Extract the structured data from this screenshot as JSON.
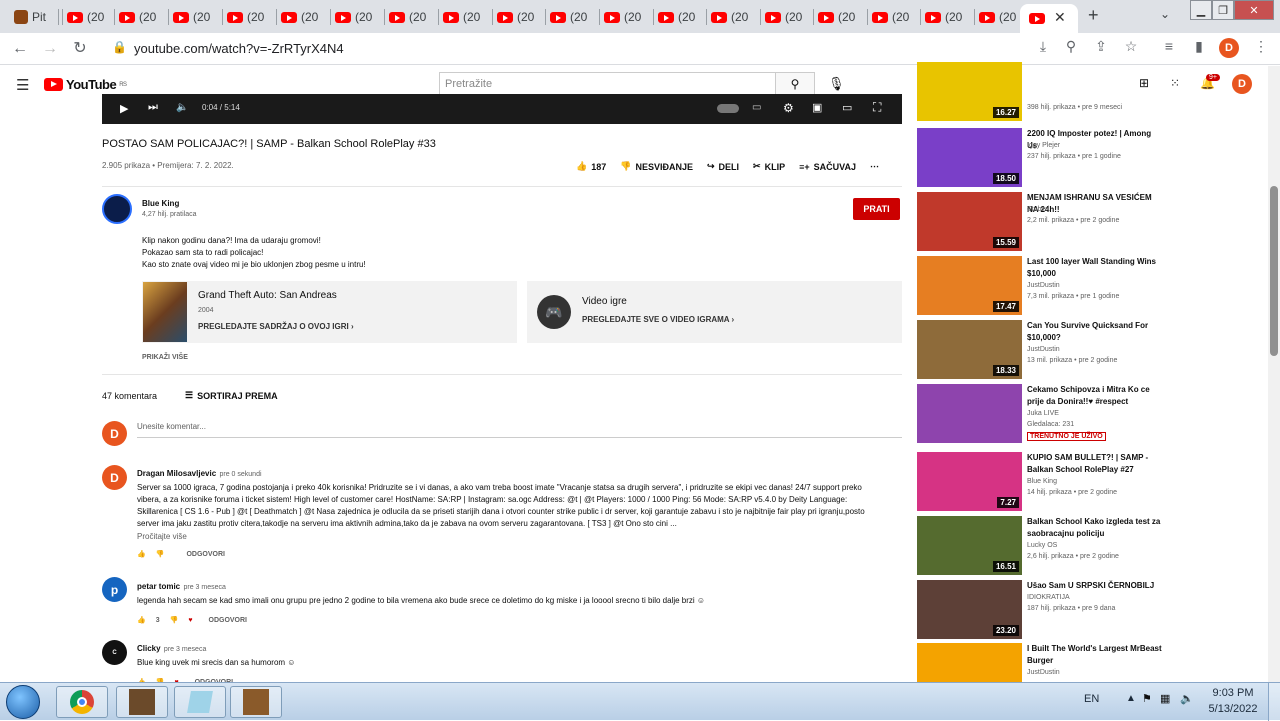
{
  "browser": {
    "first_tab_label": "Pit",
    "yt_tab_label": "(20",
    "url": "youtube.com/watch?v=-ZrRTyrX4N4",
    "profile_initial": "D"
  },
  "yt": {
    "search_placeholder": "Pretražite",
    "logo_text": "YouTube",
    "region": "RS",
    "notif_count": "9+",
    "avatar_initial": "D"
  },
  "player": {
    "time": "0:04 / 5:14"
  },
  "video": {
    "title": "POSTAO SAM POLICAJAC?! | SAMP - Balkan School RolePlay #33",
    "meta": "2.905 prikaza • Premijera: 7. 2. 2022.",
    "likes": "187",
    "dislike": "NESVIĐANJE",
    "share": "DELI",
    "clip": "KLIP",
    "save": "SAČUVAJ"
  },
  "channel": {
    "name": "Blue King",
    "subs": "4,27 hilj. pratilaca",
    "subscribe": "PRATI",
    "desc1": "Klip nakon godinu dana?! Ima da udaraju gromovi!",
    "desc2": "Pokazao sam sta to radi policajac!",
    "desc3": "Kao sto znate ovaj video mi je bio uklonjen zbog pesme u intru!",
    "show_more": "PRIKAŽI VIŠE"
  },
  "cards": {
    "game_title": "Grand Theft Auto: San Andreas",
    "game_year": "2004",
    "game_link": "PREGLEDAJTE SADRŽAJ O OVOJ IGRI",
    "cat_title": "Video igre",
    "cat_link": "PREGLEDAJTE SVE O VIDEO IGRAMA"
  },
  "comments": {
    "count": "47 komentara",
    "sort": "SORTIRAJ PREMA",
    "placeholder": "Unesite komentar...",
    "reply": "ODGOVORI",
    "read_more": "Pročitajte više",
    "items": [
      {
        "initial": "D",
        "name": "Dragan Milosavljevic",
        "time": "pre 0 sekundi",
        "text": "Server sa 1000 igraca, 7 godina postojanja i preko 40k korisnika! Pridruzite se i vi danas, a ako vam treba boost imate \"Vracanje statsa sa drugih servera\", i pridruzite se ekipi vec danas! 24/7 support preko vibera, a za korisnike foruma i ticket sistem! High level of customer care! HostName: SA:RP | Instagram: sa.ogc Address: @t | @t Players: 1000 / 1000 Ping: 56 Mode: SA:RP v5.4.0 by Deity Language: Skillarenica [ CS 1.6 - Pub ] @t [ Deathmatch ] @t Nasa zajednica je odlucila da se priseti starijih dana i otvori counter strike public i dr server, koji garantuje zabavu i sto je najbitnije fair play pri igranju,posto server ima jaku zastitu protiv citera,takodje na serveru ima aktivnih admina,tako da je zabava na ovom serveru zagarantovana. [ TS3 ] @t Ono sto cini ..."
      },
      {
        "initial": "p",
        "name": "petar tomic",
        "time": "pre 3 meseca",
        "text": "legenda hah secam se kad smo imali onu grupu pre jedno 2 godine to bila vremena ako bude srece ce doletimo do kg miske i ja looool srecno ti bilo dalje brzi ☺",
        "likes": "3"
      },
      {
        "initial": "C",
        "name": "Clicky",
        "time": "pre 3 meseca",
        "text": "Blue king uvek mi srecis dan sa humorom ☺"
      }
    ]
  },
  "recs": [
    {
      "title": "",
      "channel": "",
      "meta": "398 hilj. prikaza • pre 9 meseci",
      "duration": "16.27",
      "color": "#e8c400"
    },
    {
      "title": "2200 IQ Imposter potez! | Among Us",
      "channel": "Iggy Plejer",
      "meta": "237 hilj. prikaza • pre 1 godine",
      "duration": "18.50",
      "color": "#7a3fc8"
    },
    {
      "title": "MENJAM ISHRANU SA VESIĆEM NA 24h!!",
      "channel": "Stuberi",
      "meta": "2,2 mil. prikaza • pre 2 godine",
      "duration": "15.59",
      "color": "#c0392b"
    },
    {
      "title": "Last 100 layer Wall Standing Wins $10,000",
      "channel": "JustDustin",
      "meta": "7,3 mil. prikaza • pre 1 godine",
      "duration": "17.47",
      "color": "#e67e22"
    },
    {
      "title": "Can You Survive Quicksand For $10,000?",
      "channel": "JustDustin",
      "meta": "13 mil. prikaza • pre 2 godine",
      "duration": "18.33",
      "color": "#8e6b3a"
    },
    {
      "title": "Cekamo Schipovza i Mitra Ko ce prije da Donira!!♥ #respect",
      "channel": "Juka LIVE",
      "meta": "Gledalaca: 231",
      "live": "TRENUTNO JE UŽIVO",
      "color": "#8e44ad"
    },
    {
      "title": "KUPIO SAM BULLET?! | SAMP - Balkan School RolePlay #27",
      "channel": "Blue King",
      "meta": "14 hilj. prikaza • pre 2 godine",
      "duration": "7.27",
      "color": "#d63384"
    },
    {
      "title": "Balkan School Kako izgleda test za saobracajnu policiju",
      "channel": "Lucky OS",
      "meta": "2,6 hilj. prikaza • pre 2 godine",
      "duration": "16.51",
      "color": "#556b2f"
    },
    {
      "title": "Ušao Sam U SRPSKI ČERNOBILJ",
      "channel": "IDIOKRATIJA",
      "meta": "187 hilj. prikaza • pre 9 dana",
      "duration": "23.20",
      "color": "#5d4037"
    },
    {
      "title": "I Built The World's Largest MrBeast Burger",
      "channel": "JustDustin",
      "meta": "",
      "duration": "",
      "color": "#f4a300"
    }
  ],
  "taskbar": {
    "lang": "EN",
    "time": "9:03 PM",
    "date": "5/13/2022"
  }
}
